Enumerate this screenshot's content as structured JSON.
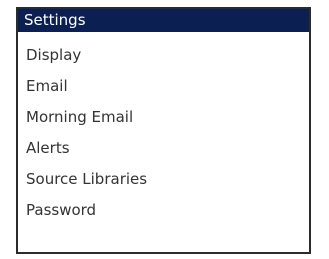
{
  "menu": {
    "header_label": "Settings",
    "header_color": "#0b1f52",
    "items": [
      {
        "label": "Display"
      },
      {
        "label": "Email"
      },
      {
        "label": "Morning Email"
      },
      {
        "label": "Alerts"
      },
      {
        "label": "Source Libraries"
      },
      {
        "label": "Password"
      }
    ]
  }
}
